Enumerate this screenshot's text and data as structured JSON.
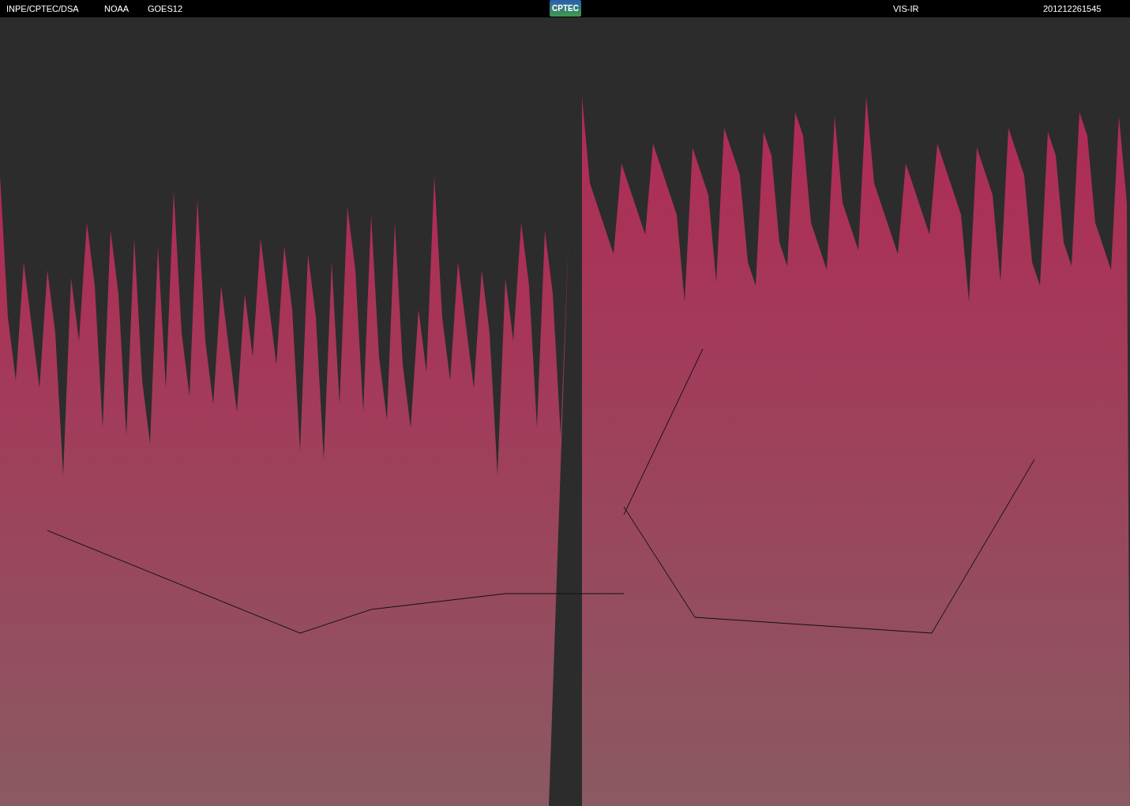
{
  "header": {
    "source": "INPE/CPTEC/DSA",
    "agency": "NOAA",
    "satellite": "GOES12",
    "logo": "CPTEC",
    "channel": "VIS-IR",
    "timestamp": "201212261545"
  }
}
